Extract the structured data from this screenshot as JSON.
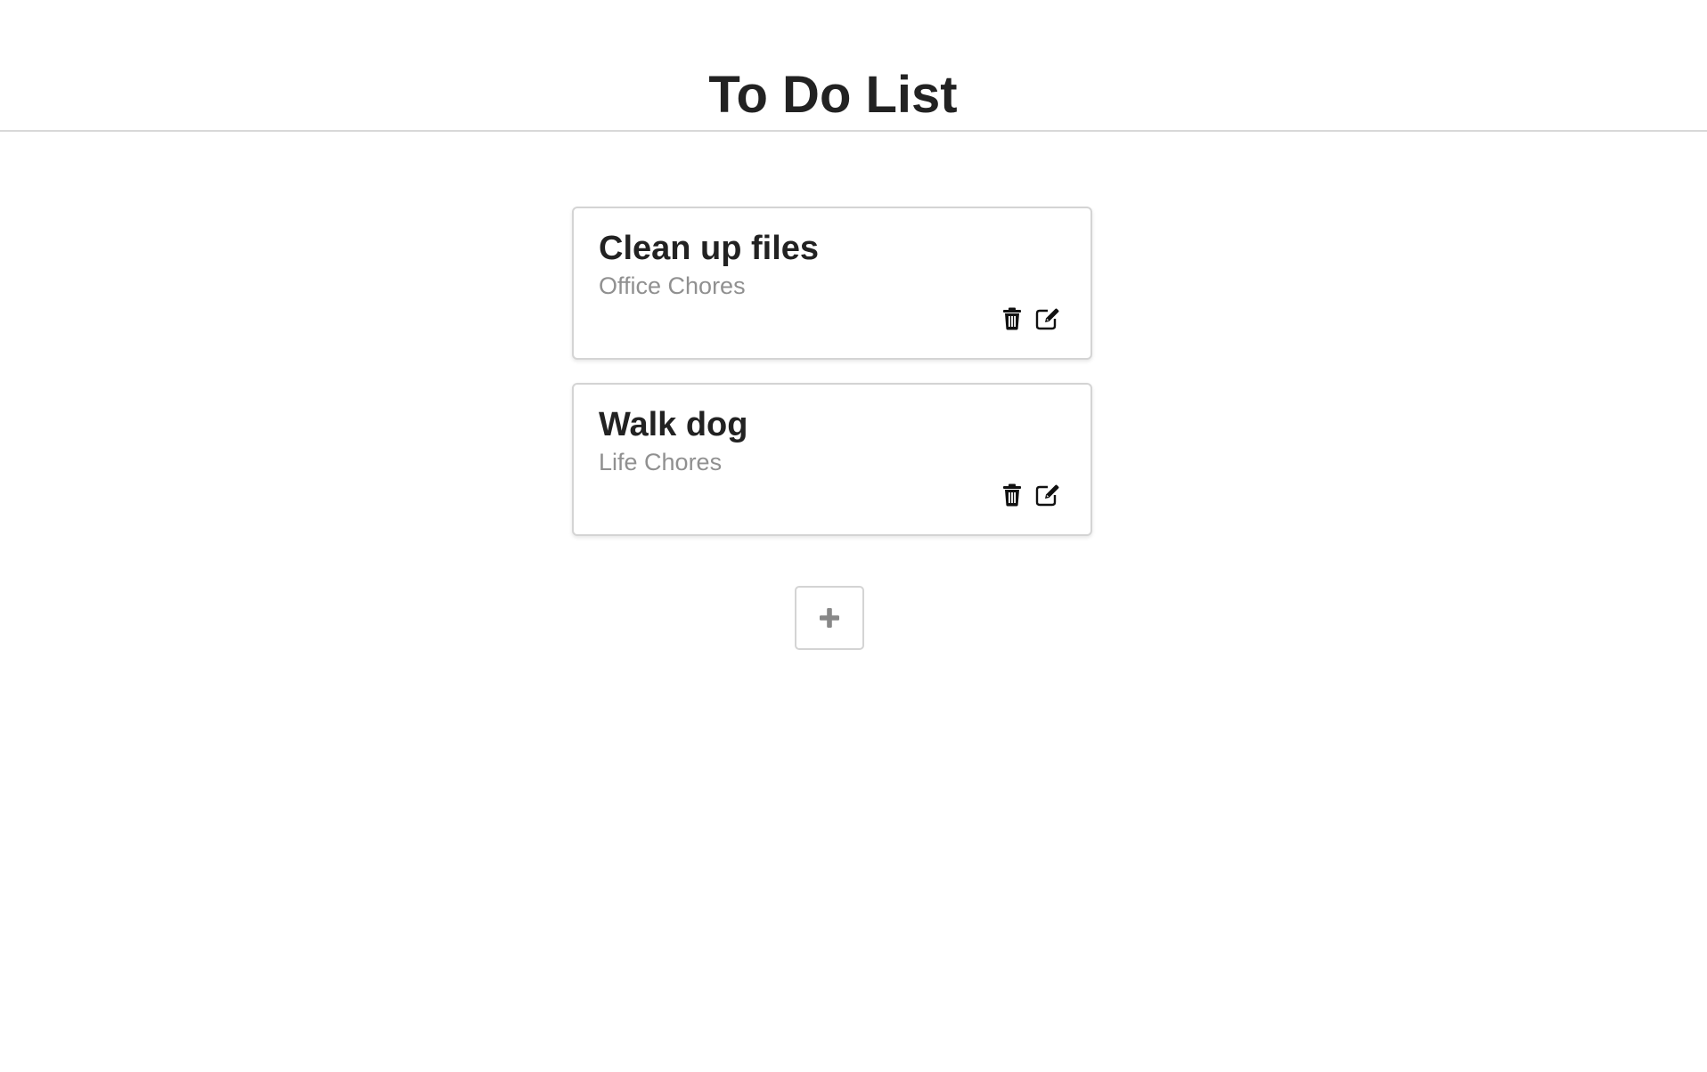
{
  "header": {
    "title": "To Do List"
  },
  "todos": [
    {
      "title": "Clean up files",
      "category": "Office Chores",
      "actions": [
        "trash-icon",
        "edit-icon"
      ]
    },
    {
      "title": "Walk dog",
      "category": "Life Chores",
      "actions": [
        "trash-icon",
        "edit-icon"
      ]
    }
  ],
  "add_button": {
    "icon": "plus-icon"
  },
  "colors": {
    "text": "#222222",
    "category_text": "#909090",
    "card_border": "#d4d4d4",
    "divider": "#d8d8d8",
    "plus_icon": "#888888"
  }
}
